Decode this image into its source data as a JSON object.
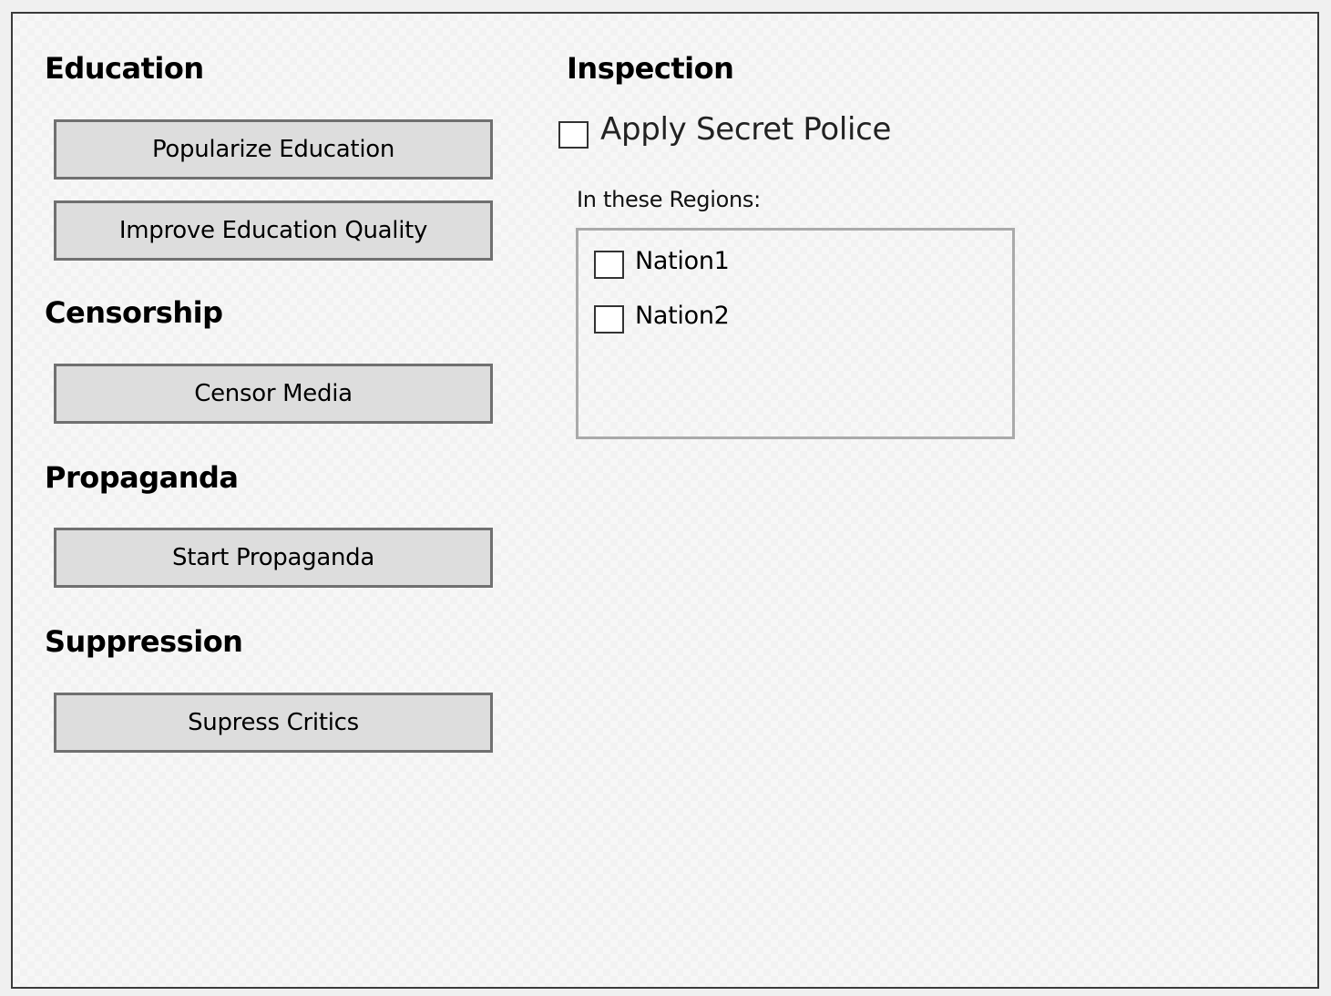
{
  "education": {
    "heading": "Education",
    "popularize_button": "Popularize Education",
    "improve_button": "Improve Education Quality"
  },
  "censorship": {
    "heading": "Censorship",
    "censor_button": "Censor Media"
  },
  "propaganda": {
    "heading": "Propaganda",
    "start_button": "Start Propaganda"
  },
  "suppression": {
    "heading": "Suppression",
    "suppress_button": "Supress Critics"
  },
  "inspection": {
    "heading": "Inspection",
    "secret_police_label": "Apply Secret Police",
    "secret_police_checked": false,
    "regions_label": "In these Regions:",
    "regions": [
      {
        "label": "Nation1",
        "checked": false
      },
      {
        "label": "Nation2",
        "checked": false
      }
    ]
  }
}
